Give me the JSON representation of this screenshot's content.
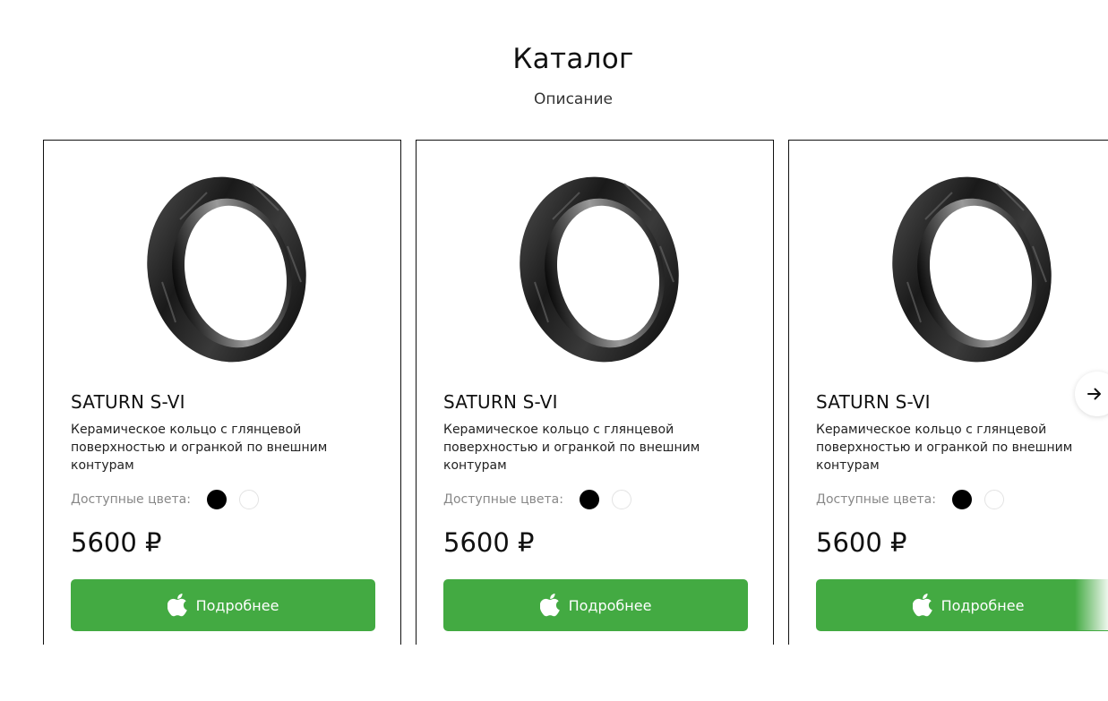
{
  "header": {
    "title": "Каталог",
    "subtitle": "Описание"
  },
  "products": [
    {
      "name": "SATURN S-VI",
      "description": "Керамическое кольцо с глянцевой поверхностью и огранкой по внешним контурам",
      "colors_label": "Доступные цвета:",
      "colors": [
        "#000000",
        "#ffffff"
      ],
      "price": "5600 ₽",
      "button_label": "Подробнее"
    },
    {
      "name": "SATURN S-VI",
      "description": "Керамическое кольцо с глянцевой поверхностью и огранкой по внешним контурам",
      "colors_label": "Доступные цвета:",
      "colors": [
        "#000000",
        "#ffffff"
      ],
      "price": "5600 ₽",
      "button_label": "Подробнее"
    },
    {
      "name": "SATURN S-VI",
      "description": "Керамическое кольцо с глянцевой поверхностью и огранкой по внешним контурам",
      "colors_label": "Доступные цвета:",
      "colors": [
        "#000000",
        "#ffffff"
      ],
      "price": "5600 ₽",
      "button_label": "Подробнее"
    }
  ],
  "carousel": {
    "next_icon": "arrow-right-icon"
  },
  "theme": {
    "accent": "#43aa42",
    "text": "#111111",
    "muted": "#888888"
  }
}
